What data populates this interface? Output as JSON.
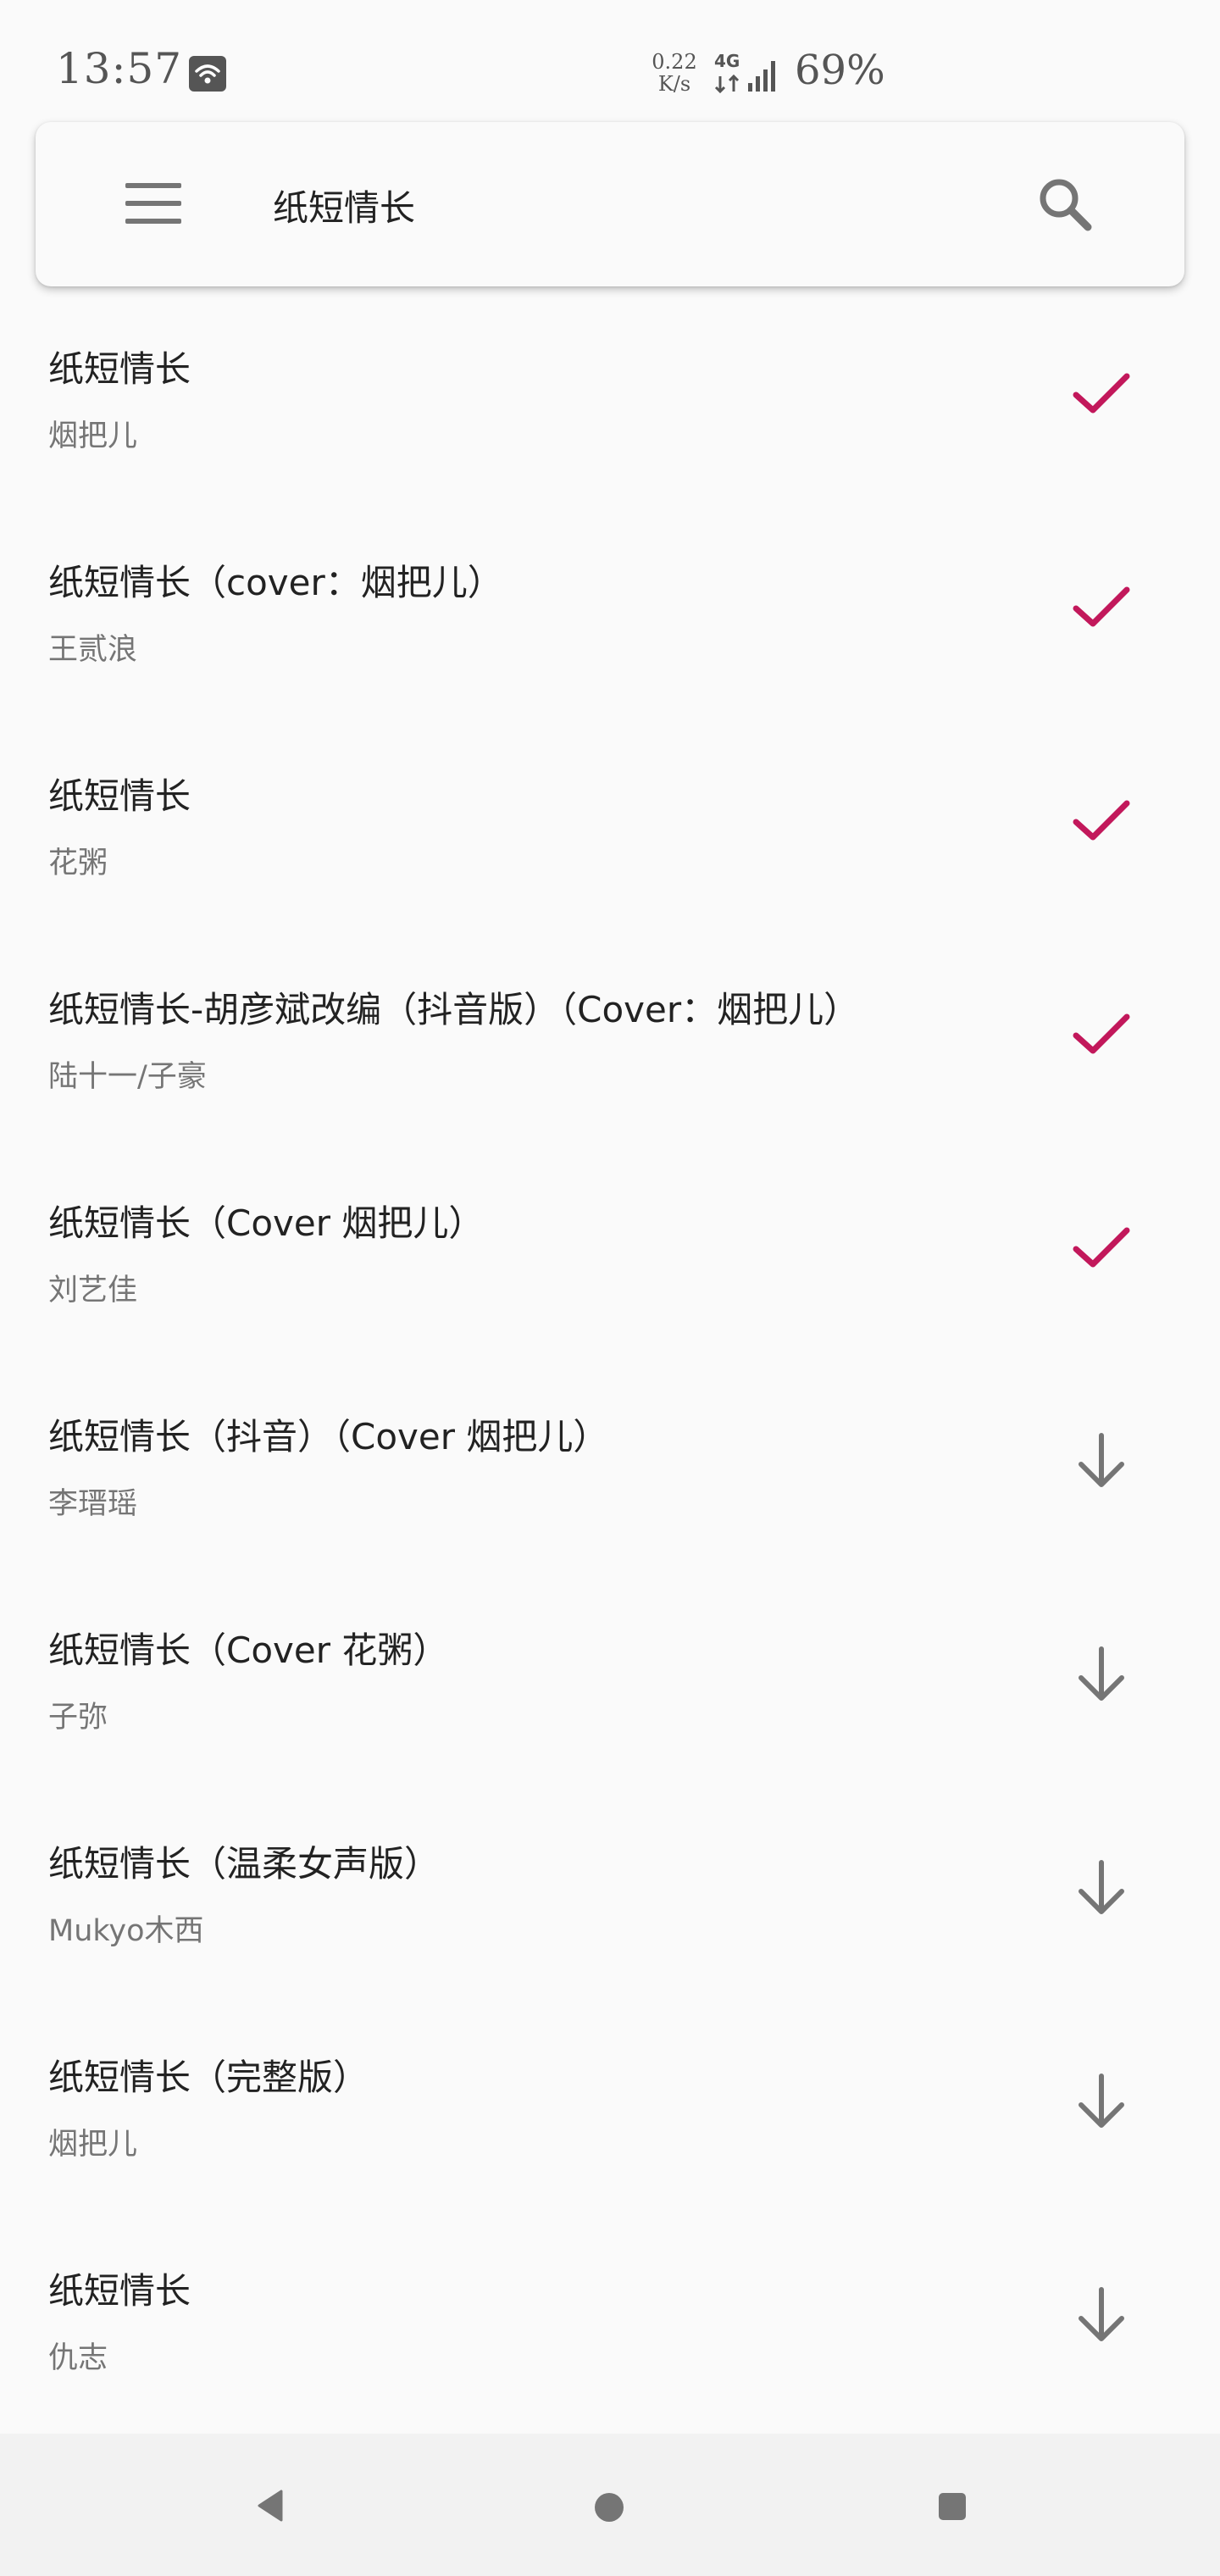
{
  "status_bar": {
    "time": "13:57",
    "net_speed_value": "0.22",
    "net_speed_unit": "K/s",
    "network_type": "4G",
    "battery": "69%"
  },
  "search": {
    "query": "纸短情长",
    "menu_icon": "menu-icon",
    "search_icon": "search-icon"
  },
  "colors": {
    "accent": "#c2185b",
    "icon_gray": "#757575",
    "background": "#fafafa"
  },
  "results": [
    {
      "title": "纸短情长",
      "artist": "烟把儿",
      "status": "downloaded",
      "icon": "check-icon"
    },
    {
      "title": "纸短情长（cover：烟把儿）",
      "artist": "王贰浪",
      "status": "downloaded",
      "icon": "check-icon"
    },
    {
      "title": "纸短情长",
      "artist": "花粥",
      "status": "downloaded",
      "icon": "check-icon"
    },
    {
      "title": "纸短情长-胡彦斌改编（抖音版）（Cover：烟把儿）",
      "artist": "陆十一/子豪",
      "status": "downloaded",
      "icon": "check-icon"
    },
    {
      "title": "纸短情长（Cover 烟把儿）",
      "artist": "刘艺佳",
      "status": "downloaded",
      "icon": "check-icon"
    },
    {
      "title": "纸短情长（抖音）（Cover 烟把儿）",
      "artist": "李瑨瑶",
      "status": "download",
      "icon": "download-arrow-icon"
    },
    {
      "title": "纸短情长（Cover 花粥）",
      "artist": "子弥",
      "status": "download",
      "icon": "download-arrow-icon"
    },
    {
      "title": "纸短情长（温柔女声版）",
      "artist": "Mukyo木西",
      "status": "download",
      "icon": "download-arrow-icon"
    },
    {
      "title": "纸短情长（完整版）",
      "artist": "烟把儿",
      "status": "download",
      "icon": "download-arrow-icon"
    },
    {
      "title": "纸短情长",
      "artist": "仇志",
      "status": "download",
      "icon": "download-arrow-icon"
    }
  ],
  "nav_bar": {
    "back_icon": "back-triangle-icon",
    "home_icon": "home-circle-icon",
    "recent_icon": "recent-square-icon"
  }
}
